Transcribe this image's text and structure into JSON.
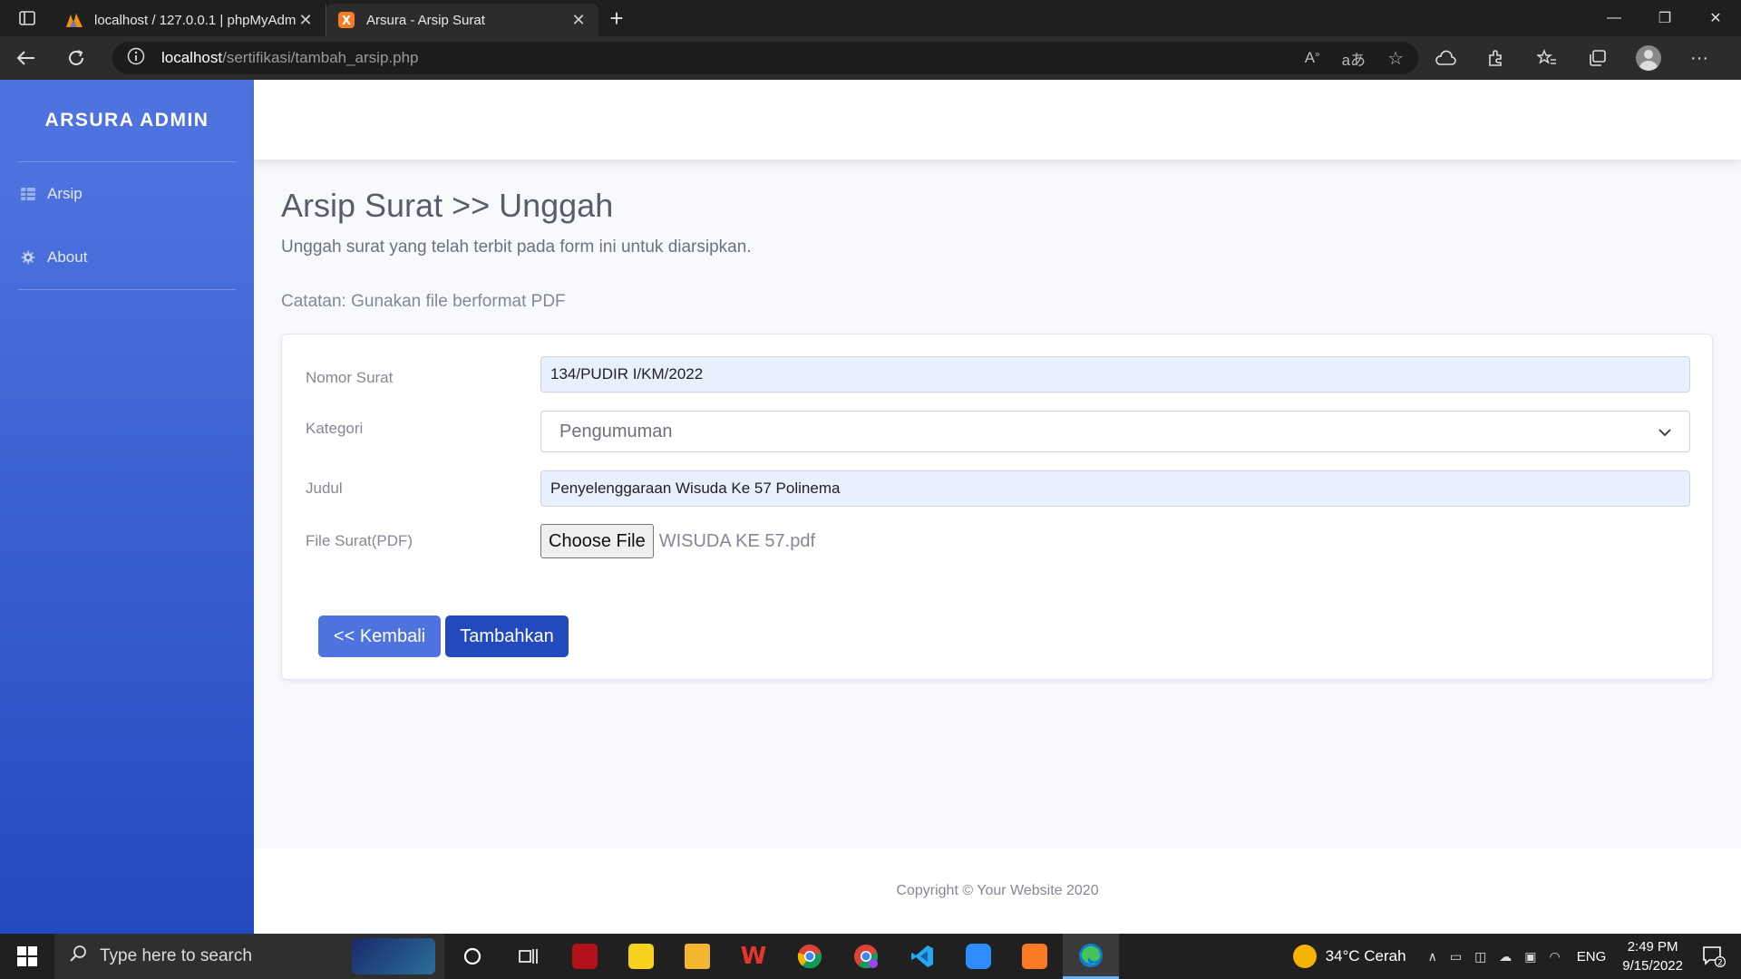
{
  "browser": {
    "tabs": [
      {
        "title": "localhost / 127.0.0.1 | phpMyAdmin",
        "icon": "phpmyadmin-icon",
        "active": false
      },
      {
        "title": "Arsura - Arsip Surat",
        "icon": "xampp-icon",
        "active": true
      }
    ],
    "url_host": "localhost",
    "url_path": "/sertifikasi/tambah_arsip.php"
  },
  "sidebar": {
    "brand": "ARSURA ADMIN",
    "items": [
      {
        "label": "Arsip",
        "icon": "table-icon"
      },
      {
        "label": "About",
        "icon": "gear-icon"
      }
    ]
  },
  "main": {
    "title": "Arsip Surat >> Unggah",
    "subtitle": "Unggah surat yang telah terbit pada form ini untuk diarsipkan.",
    "note": "Catatan: Gunakan file berformat PDF"
  },
  "form": {
    "nomor_label": "Nomor Surat",
    "nomor_value": "134/PUDIR I/KM/2022",
    "kategori_label": "Kategori",
    "kategori_value": "Pengumuman",
    "judul_label": "Judul",
    "judul_value": "Penyelenggaraan Wisuda Ke 57 Polinema",
    "file_label": "File Surat(PDF)",
    "file_button": "Choose File",
    "file_name": "WISUDA KE 57.pdf",
    "back_button": "<< Kembali",
    "submit_button": "Tambahkan"
  },
  "footer": {
    "text": "Copyright © Your Website 2020"
  },
  "taskbar": {
    "search_placeholder": "Type here to search",
    "weather": "34°C  Cerah",
    "language": "ENG",
    "time": "2:49 PM",
    "date": "9/15/2022",
    "notification_count": "2"
  },
  "colors": {
    "sidebar_top": "#4e73df",
    "sidebar_bottom": "#224abe",
    "primary": "#4e73df"
  }
}
